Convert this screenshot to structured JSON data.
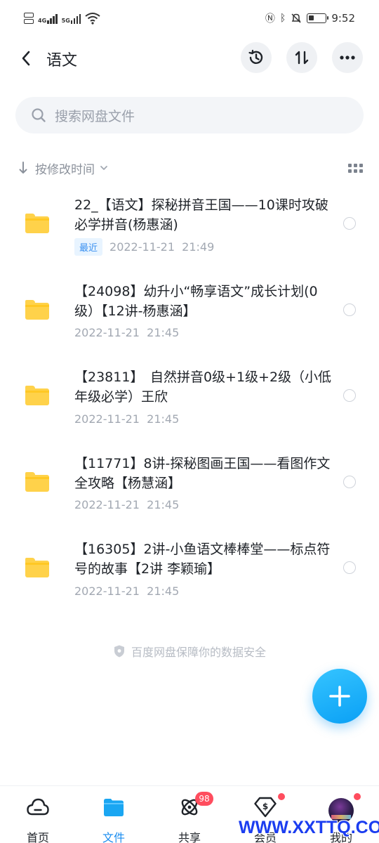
{
  "status_bar": {
    "net_sim1": "4G",
    "net_sim2": "5G",
    "time": "9:52",
    "battery_level": 0.3
  },
  "header": {
    "title": "语文",
    "back_icon": "chevron-left-icon",
    "history_icon": "history-icon",
    "sort_icon": "sort-arrows-icon",
    "more_icon": "more-dots-icon"
  },
  "search": {
    "placeholder": "搜索网盘文件"
  },
  "sort": {
    "label": "按修改时间"
  },
  "files": [
    {
      "name": "22_【语文】探秘拼音王国——10课时攻破必学拼音(杨惠涵)",
      "badge": "最近",
      "date": "2022-11-21",
      "time": "21:49"
    },
    {
      "name": "【24098】幼升小“畅享语文”成长计划(0级）【12讲-杨惠涵】",
      "badge": "",
      "date": "2022-11-21",
      "time": "21:45"
    },
    {
      "name": "【23811】　自然拼音0级+1级+2级（小低年级必学）王欣",
      "badge": "",
      "date": "2022-11-21",
      "time": "21:45"
    },
    {
      "name": "【11771】8讲-探秘图画王国——看图作文全攻略【杨慧涵】",
      "badge": "",
      "date": "2022-11-21",
      "time": "21:45"
    },
    {
      "name": "【16305】2讲-小鱼语文棒棒堂——标点符号的故事【2讲 李颖瑜】",
      "badge": "",
      "date": "2022-11-21",
      "time": "21:45"
    }
  ],
  "footer_note": "百度网盘保障你的数据安全",
  "fab": {
    "icon": "plus-icon"
  },
  "tabbar": {
    "tabs": [
      {
        "label": "首页",
        "icon": "cloud-icon"
      },
      {
        "label": "文件",
        "icon": "folder-icon"
      },
      {
        "label": "共享",
        "icon": "share-atom-icon",
        "badge": "98"
      },
      {
        "label": "会员",
        "icon": "vip-diamond-icon"
      },
      {
        "label": "我的",
        "icon": "avatar"
      }
    ],
    "active_color": "#1a8df0"
  },
  "watermark": "WWW.XXTTQ.COM",
  "colors": {
    "accent": "#1a8df0",
    "folder": "#ffd24a",
    "badge_red": "#ff4d5e"
  }
}
